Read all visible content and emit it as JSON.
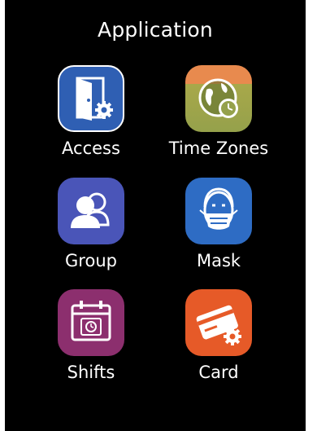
{
  "screen": {
    "title": "Application"
  },
  "apps": [
    {
      "label": "Access",
      "icon": "door-gear-icon",
      "color": "#2f5fb3"
    },
    {
      "label": "Time Zones",
      "icon": "globe-clock-icon",
      "color": "#e88a4e"
    },
    {
      "label": "Group",
      "icon": "users-icon",
      "color": "#4a55b8"
    },
    {
      "label": "Mask",
      "icon": "face-mask-icon",
      "color": "#2e6cc4"
    },
    {
      "label": "Shifts",
      "icon": "calendar-clock-icon",
      "color": "#8c2f6e"
    },
    {
      "label": "Card",
      "icon": "card-gear-icon",
      "color": "#e65a28"
    }
  ],
  "selected_app": "Access"
}
